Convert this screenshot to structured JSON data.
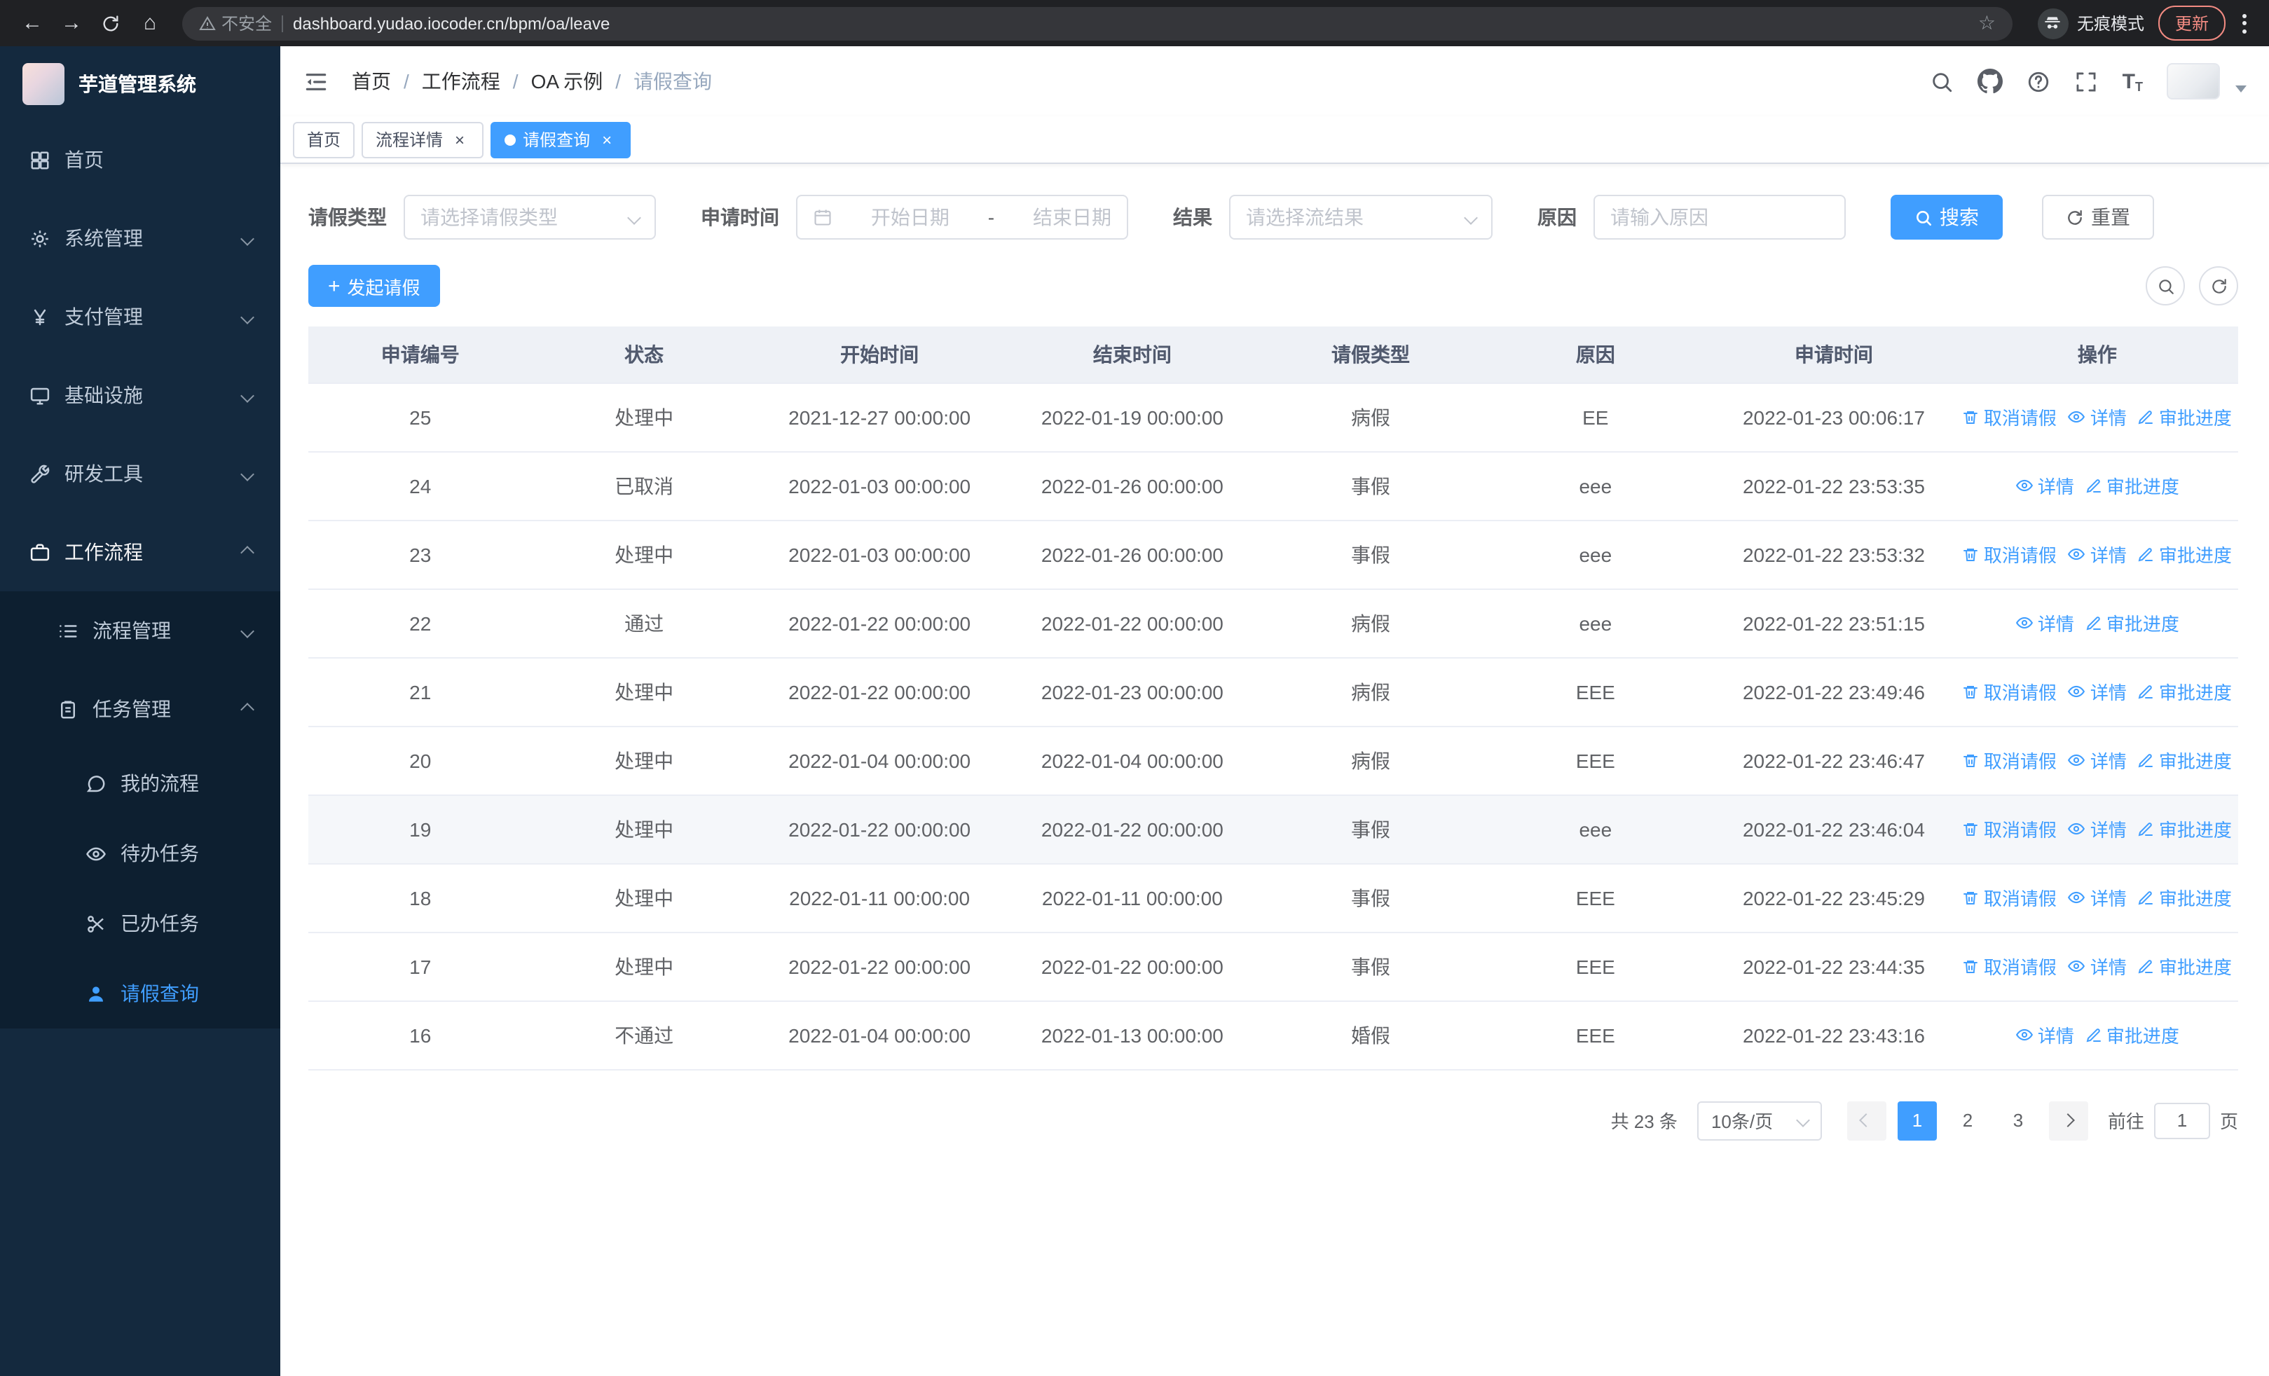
{
  "colors": {
    "accent": "#409eff",
    "sidebar_bg": "#14293e",
    "submenu_bg": "#0d1f30"
  },
  "browser": {
    "security_label": "不安全",
    "url": "dashboard.yudao.iocoder.cn/bpm/oa/leave",
    "incognito_label": "无痕模式",
    "update_label": "更新"
  },
  "sidebar": {
    "logo_title": "芋道管理系统",
    "items": [
      {
        "label": "首页"
      },
      {
        "label": "系统管理"
      },
      {
        "label": "支付管理"
      },
      {
        "label": "基础设施"
      },
      {
        "label": "研发工具"
      },
      {
        "label": "工作流程"
      }
    ],
    "workflow_children": [
      {
        "label": "流程管理"
      },
      {
        "label": "任务管理"
      }
    ],
    "task_children": [
      {
        "label": "我的流程"
      },
      {
        "label": "待办任务"
      },
      {
        "label": "已办任务"
      },
      {
        "label": "请假查询"
      }
    ]
  },
  "header": {
    "breadcrumb": [
      "首页",
      "工作流程",
      "OA 示例",
      "请假查询"
    ]
  },
  "tabs": [
    {
      "label": "首页"
    },
    {
      "label": "流程详情"
    },
    {
      "label": "请假查询"
    }
  ],
  "filters": {
    "leave_type_label": "请假类型",
    "leave_type_placeholder": "请选择请假类型",
    "apply_time_label": "申请时间",
    "start_date_placeholder": "开始日期",
    "range_separator": "-",
    "end_date_placeholder": "结束日期",
    "result_label": "结果",
    "result_placeholder": "请选择流结果",
    "reason_label": "原因",
    "reason_placeholder": "请输入原因",
    "search_label": "搜索",
    "reset_label": "重置"
  },
  "toolbar": {
    "create_label": "发起请假"
  },
  "table": {
    "columns": [
      "申请编号",
      "状态",
      "开始时间",
      "结束时间",
      "请假类型",
      "原因",
      "申请时间",
      "操作"
    ],
    "actions": {
      "cancel": "取消请假",
      "detail": "详情",
      "progress": "审批进度"
    },
    "rows": [
      {
        "id": "25",
        "status": "处理中",
        "start_time": "2021-12-27 00:00:00",
        "end_time": "2022-01-19 00:00:00",
        "leave_type": "病假",
        "reason": "EE",
        "apply_time": "2022-01-23 00:06:17",
        "can_cancel": true,
        "highlighted": false
      },
      {
        "id": "24",
        "status": "已取消",
        "start_time": "2022-01-03 00:00:00",
        "end_time": "2022-01-26 00:00:00",
        "leave_type": "事假",
        "reason": "eee",
        "apply_time": "2022-01-22 23:53:35",
        "can_cancel": false,
        "highlighted": false
      },
      {
        "id": "23",
        "status": "处理中",
        "start_time": "2022-01-03 00:00:00",
        "end_time": "2022-01-26 00:00:00",
        "leave_type": "事假",
        "reason": "eee",
        "apply_time": "2022-01-22 23:53:32",
        "can_cancel": true,
        "highlighted": false
      },
      {
        "id": "22",
        "status": "通过",
        "start_time": "2022-01-22 00:00:00",
        "end_time": "2022-01-22 00:00:00",
        "leave_type": "病假",
        "reason": "eee",
        "apply_time": "2022-01-22 23:51:15",
        "can_cancel": false,
        "highlighted": false
      },
      {
        "id": "21",
        "status": "处理中",
        "start_time": "2022-01-22 00:00:00",
        "end_time": "2022-01-23 00:00:00",
        "leave_type": "病假",
        "reason": "EEE",
        "apply_time": "2022-01-22 23:49:46",
        "can_cancel": true,
        "highlighted": false
      },
      {
        "id": "20",
        "status": "处理中",
        "start_time": "2022-01-04 00:00:00",
        "end_time": "2022-01-04 00:00:00",
        "leave_type": "病假",
        "reason": "EEE",
        "apply_time": "2022-01-22 23:46:47",
        "can_cancel": true,
        "highlighted": false
      },
      {
        "id": "19",
        "status": "处理中",
        "start_time": "2022-01-22 00:00:00",
        "end_time": "2022-01-22 00:00:00",
        "leave_type": "事假",
        "reason": "eee",
        "apply_time": "2022-01-22 23:46:04",
        "can_cancel": true,
        "highlighted": true
      },
      {
        "id": "18",
        "status": "处理中",
        "start_time": "2022-01-11 00:00:00",
        "end_time": "2022-01-11 00:00:00",
        "leave_type": "事假",
        "reason": "EEE",
        "apply_time": "2022-01-22 23:45:29",
        "can_cancel": true,
        "highlighted": false
      },
      {
        "id": "17",
        "status": "处理中",
        "start_time": "2022-01-22 00:00:00",
        "end_time": "2022-01-22 00:00:00",
        "leave_type": "事假",
        "reason": "EEE",
        "apply_time": "2022-01-22 23:44:35",
        "can_cancel": true,
        "highlighted": false
      },
      {
        "id": "16",
        "status": "不通过",
        "start_time": "2022-01-04 00:00:00",
        "end_time": "2022-01-13 00:00:00",
        "leave_type": "婚假",
        "reason": "EEE",
        "apply_time": "2022-01-22 23:43:16",
        "can_cancel": false,
        "highlighted": false
      }
    ]
  },
  "pagination": {
    "total_label": "共 23 条",
    "page_size_label": "10条/页",
    "pages": [
      "1",
      "2",
      "3"
    ],
    "active_page": "1",
    "goto_label": "前往",
    "goto_value": "1",
    "page_suffix": "页"
  }
}
